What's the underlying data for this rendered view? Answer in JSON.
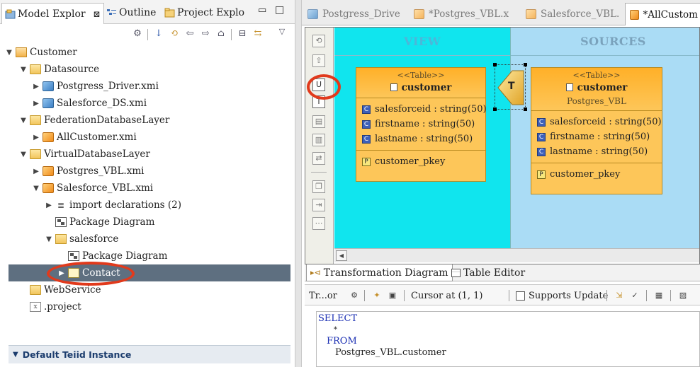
{
  "left_tabs": [
    {
      "label": "Model Explor",
      "close": "⊠"
    },
    {
      "label": "Outline"
    },
    {
      "label": "Project Explo"
    }
  ],
  "window_controls": {
    "minimize": "▭",
    "maximize": "□"
  },
  "tree": [
    {
      "label": "Customer",
      "icon": "project-icon",
      "twisty": "▼",
      "indent": 0
    },
    {
      "label": "Datasource",
      "icon": "folder-icon",
      "twisty": "▼",
      "indent": 1
    },
    {
      "label": "Postgress_Driver.xmi",
      "icon": "source-model-icon",
      "twisty": "▶",
      "indent": 2
    },
    {
      "label": "Salesforce_DS.xmi",
      "icon": "source-model-icon",
      "twisty": "▶",
      "indent": 2
    },
    {
      "label": "FederationDatabaseLayer",
      "icon": "folder-icon",
      "twisty": "▼",
      "indent": 1
    },
    {
      "label": "AllCustomer.xmi",
      "icon": "view-model-icon",
      "twisty": "▶",
      "indent": 2
    },
    {
      "label": "VirtualDatabaseLayer",
      "icon": "folder-icon",
      "twisty": "▼",
      "indent": 1
    },
    {
      "label": "Postgres_VBL.xmi",
      "icon": "view-model-icon",
      "twisty": "▶",
      "indent": 2
    },
    {
      "label": "Salesforce_VBL.xmi",
      "icon": "view-model-icon",
      "twisty": "▼",
      "indent": 2
    },
    {
      "label": "import declarations (2)",
      "icon": "import-icon",
      "twisty": "▶",
      "indent": 3
    },
    {
      "label": "Package Diagram",
      "icon": "diagram-icon",
      "twisty": "",
      "indent": 3
    },
    {
      "label": "salesforce",
      "icon": "package-icon",
      "twisty": "▼",
      "indent": 3
    },
    {
      "label": "Package Diagram",
      "icon": "diagram-icon",
      "twisty": "",
      "indent": 4
    },
    {
      "label": "Contact",
      "icon": "table-icon",
      "twisty": "▶",
      "indent": 4,
      "selected": true
    },
    {
      "label": "WebService",
      "icon": "folder-icon",
      "twisty": "",
      "indent": 1
    },
    {
      "label": ".project",
      "icon": "file-icon",
      "twisty": "",
      "indent": 1
    }
  ],
  "teiid_panel": {
    "label": "Default Teiid Instance",
    "twisty": "▼"
  },
  "editor_tabs": [
    {
      "label": "Postgress_Drive"
    },
    {
      "label": "*Postgres_VBL.x"
    },
    {
      "label": "Salesforce_VBL."
    },
    {
      "label": "*AllCustom",
      "active": true
    }
  ],
  "diagram": {
    "view_header": "VIEW",
    "sources_header": "SOURCES",
    "view_table": {
      "stereotype": "<<Table>>",
      "name": "customer",
      "attributes": [
        "salesforceid : string(50)",
        "firstname : string(50)",
        "lastname : string(50)"
      ],
      "primary_key": "customer_pkey"
    },
    "source_table": {
      "stereotype": "<<Table>>",
      "name": "customer",
      "model": "Postgres_VBL",
      "attributes": [
        "salesforceid : string(50)",
        "firstname : string(50)",
        "lastname : string(50)"
      ],
      "primary_key": "customer_pkey"
    },
    "transformation_label": "T",
    "attr_icon_letter": "C",
    "pk_icon_letter": "P"
  },
  "view_tabs": [
    {
      "label": "Transformation Diagram",
      "active": true
    },
    {
      "label": "Table Editor"
    }
  ],
  "transformation_toolbar": {
    "title": "Tr...or",
    "cursor": "Cursor at (1, 1)",
    "supports_update": "Supports Update"
  },
  "sql_lines": [
    "SELECT",
    "*",
    "FROM",
    "Postgres_VBL.customer"
  ],
  "colors": {
    "view_bg": "#10e5ee",
    "sources_bg": "#aadcf5",
    "table_fill": "#fdc659",
    "selection": "#5e6f80",
    "callout": "#e13a1c",
    "sql_keyword": "#1b2fb3"
  }
}
